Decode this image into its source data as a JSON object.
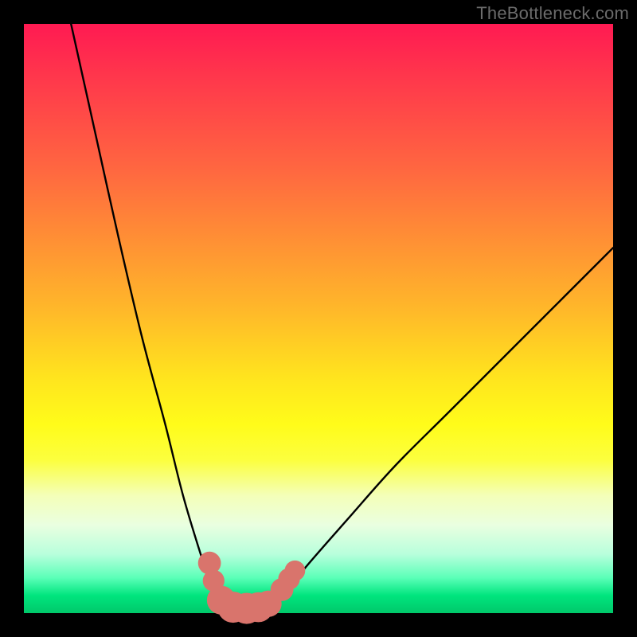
{
  "watermark": "TheBottleneck.com",
  "chart_data": {
    "type": "line",
    "title": "",
    "xlabel": "",
    "ylabel": "",
    "xlim": [
      0,
      100
    ],
    "ylim": [
      0,
      100
    ],
    "grid": false,
    "series": [
      {
        "name": "left-curve",
        "x": [
          8,
          12,
          16,
          20,
          24,
          27,
          30,
          32,
          33.5,
          35
        ],
        "y": [
          100,
          82,
          64,
          47,
          32,
          20,
          10,
          4,
          1.5,
          0.5
        ]
      },
      {
        "name": "bottom-flat",
        "x": [
          35,
          37,
          39,
          41
        ],
        "y": [
          0.5,
          0.3,
          0.3,
          0.6
        ]
      },
      {
        "name": "right-curve",
        "x": [
          41,
          44,
          48,
          55,
          63,
          72,
          82,
          92,
          100
        ],
        "y": [
          0.6,
          3,
          8,
          16,
          25,
          34,
          44,
          54,
          62
        ]
      }
    ],
    "markers": {
      "name": "dots",
      "color": "#d9746c",
      "points": [
        {
          "x": 31.5,
          "y": 8.5,
          "r": 1.4
        },
        {
          "x": 32.2,
          "y": 5.5,
          "r": 1.3
        },
        {
          "x": 33.5,
          "y": 2.2,
          "r": 1.9
        },
        {
          "x": 35.5,
          "y": 1.0,
          "r": 2.1
        },
        {
          "x": 37.8,
          "y": 0.8,
          "r": 2.1
        },
        {
          "x": 39.8,
          "y": 1.0,
          "r": 2.0
        },
        {
          "x": 41.5,
          "y": 1.6,
          "r": 1.7
        },
        {
          "x": 43.8,
          "y": 4.0,
          "r": 1.4
        },
        {
          "x": 45.0,
          "y": 5.8,
          "r": 1.3
        },
        {
          "x": 46.0,
          "y": 7.2,
          "r": 1.2
        }
      ]
    }
  }
}
